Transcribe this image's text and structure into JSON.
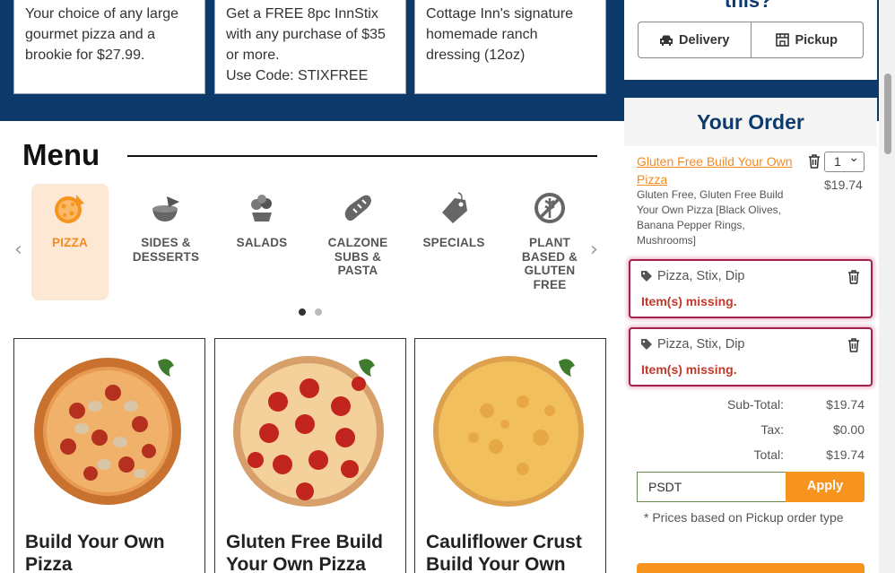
{
  "promos": [
    {
      "text": "Your choice of any large gourmet pizza and a brookie for $27.99."
    },
    {
      "text": "Get a FREE 8pc InnStix with any purchase of $35 or more.\nUse Code: STIXFREE"
    },
    {
      "text": "Cottage Inn's signature homemade ranch dressing (12oz)"
    }
  ],
  "menu": {
    "title": "Menu",
    "categories": [
      {
        "label": "PIZZA",
        "icon": "pizza-icon",
        "active": true
      },
      {
        "label": "SIDES & DESSERTS",
        "icon": "bowl-icon"
      },
      {
        "label": "SALADS",
        "icon": "salad-icon"
      },
      {
        "label": "CALZONE SUBS & PASTA",
        "icon": "bread-icon"
      },
      {
        "label": "SPECIALS",
        "icon": "tag-icon"
      },
      {
        "label": "PLANT BASED & GLUTEN FREE",
        "icon": "no-wheat-icon"
      }
    ],
    "prev_arrow": "‹",
    "next_arrow": "›"
  },
  "products": [
    {
      "name": "Build Your Own Pizza"
    },
    {
      "name": "Gluten Free Build Your Own Pizza"
    },
    {
      "name": "Cauliflower Crust Build Your Own"
    }
  ],
  "fulfillment": {
    "heading": "this?",
    "delivery_label": "Delivery",
    "pickup_label": "Pickup"
  },
  "order": {
    "heading": "Your Order",
    "item": {
      "name": "Gluten Free Build Your Own Pizza",
      "description": "Gluten Free, Gluten Free Build Your Own Pizza [Black Olives, Banana Pepper Rings, Mushrooms]",
      "qty": "1",
      "price": "$19.74"
    },
    "missing": [
      {
        "title": "Pizza, Stix, Dip",
        "warning": "Item(s) missing."
      },
      {
        "title": "Pizza, Stix, Dip",
        "warning": "Item(s) missing."
      }
    ],
    "subtotal_label": "Sub-Total:",
    "subtotal": "$19.74",
    "tax_label": "Tax:",
    "tax": "$0.00",
    "total_label": "Total:",
    "total": "$19.74",
    "promo_code": "PSDT",
    "apply_label": "Apply",
    "price_note": "* Prices based on Pickup order type"
  },
  "colors": {
    "brand_blue": "#0d3a6b",
    "accent_orange": "#f58a1f",
    "warning_red": "#c0392b"
  }
}
